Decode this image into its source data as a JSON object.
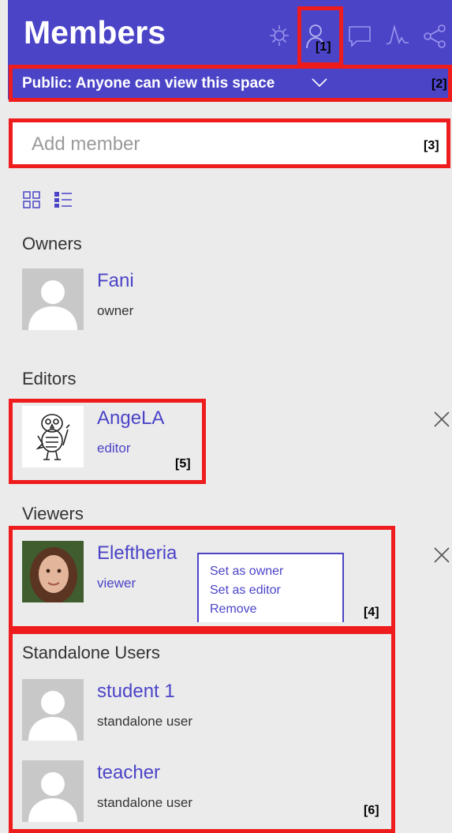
{
  "header": {
    "title": "Members",
    "icons": [
      "gear-icon",
      "members-icon",
      "chat-icon",
      "activity-icon",
      "share-icon"
    ],
    "accent_color": "#4b44c7"
  },
  "visibility": {
    "label": "Public: Anyone can view this space"
  },
  "add_member": {
    "placeholder": "Add member"
  },
  "view_toggle": {
    "icons": [
      "grid-view-icon",
      "list-view-icon"
    ]
  },
  "sections": {
    "owners": {
      "heading": "Owners",
      "members": [
        {
          "name": "Fani",
          "role": "owner"
        }
      ]
    },
    "editors": {
      "heading": "Editors",
      "members": [
        {
          "name": "AngeLA",
          "role": "editor"
        }
      ]
    },
    "viewers": {
      "heading": "Viewers",
      "members": [
        {
          "name": "Eleftheria",
          "role": "viewer"
        }
      ]
    },
    "standalone": {
      "heading": "Standalone Users",
      "members": [
        {
          "name": "student 1",
          "role": "standalone user"
        },
        {
          "name": "teacher",
          "role": "standalone user"
        }
      ]
    }
  },
  "role_menu": {
    "items": [
      "Set as owner",
      "Set as editor",
      "Remove"
    ]
  },
  "annotations": [
    "[1]",
    "[2]",
    "[3]",
    "[4]",
    "[5]",
    "[6]"
  ],
  "annotation_color": "#ee1c1c"
}
